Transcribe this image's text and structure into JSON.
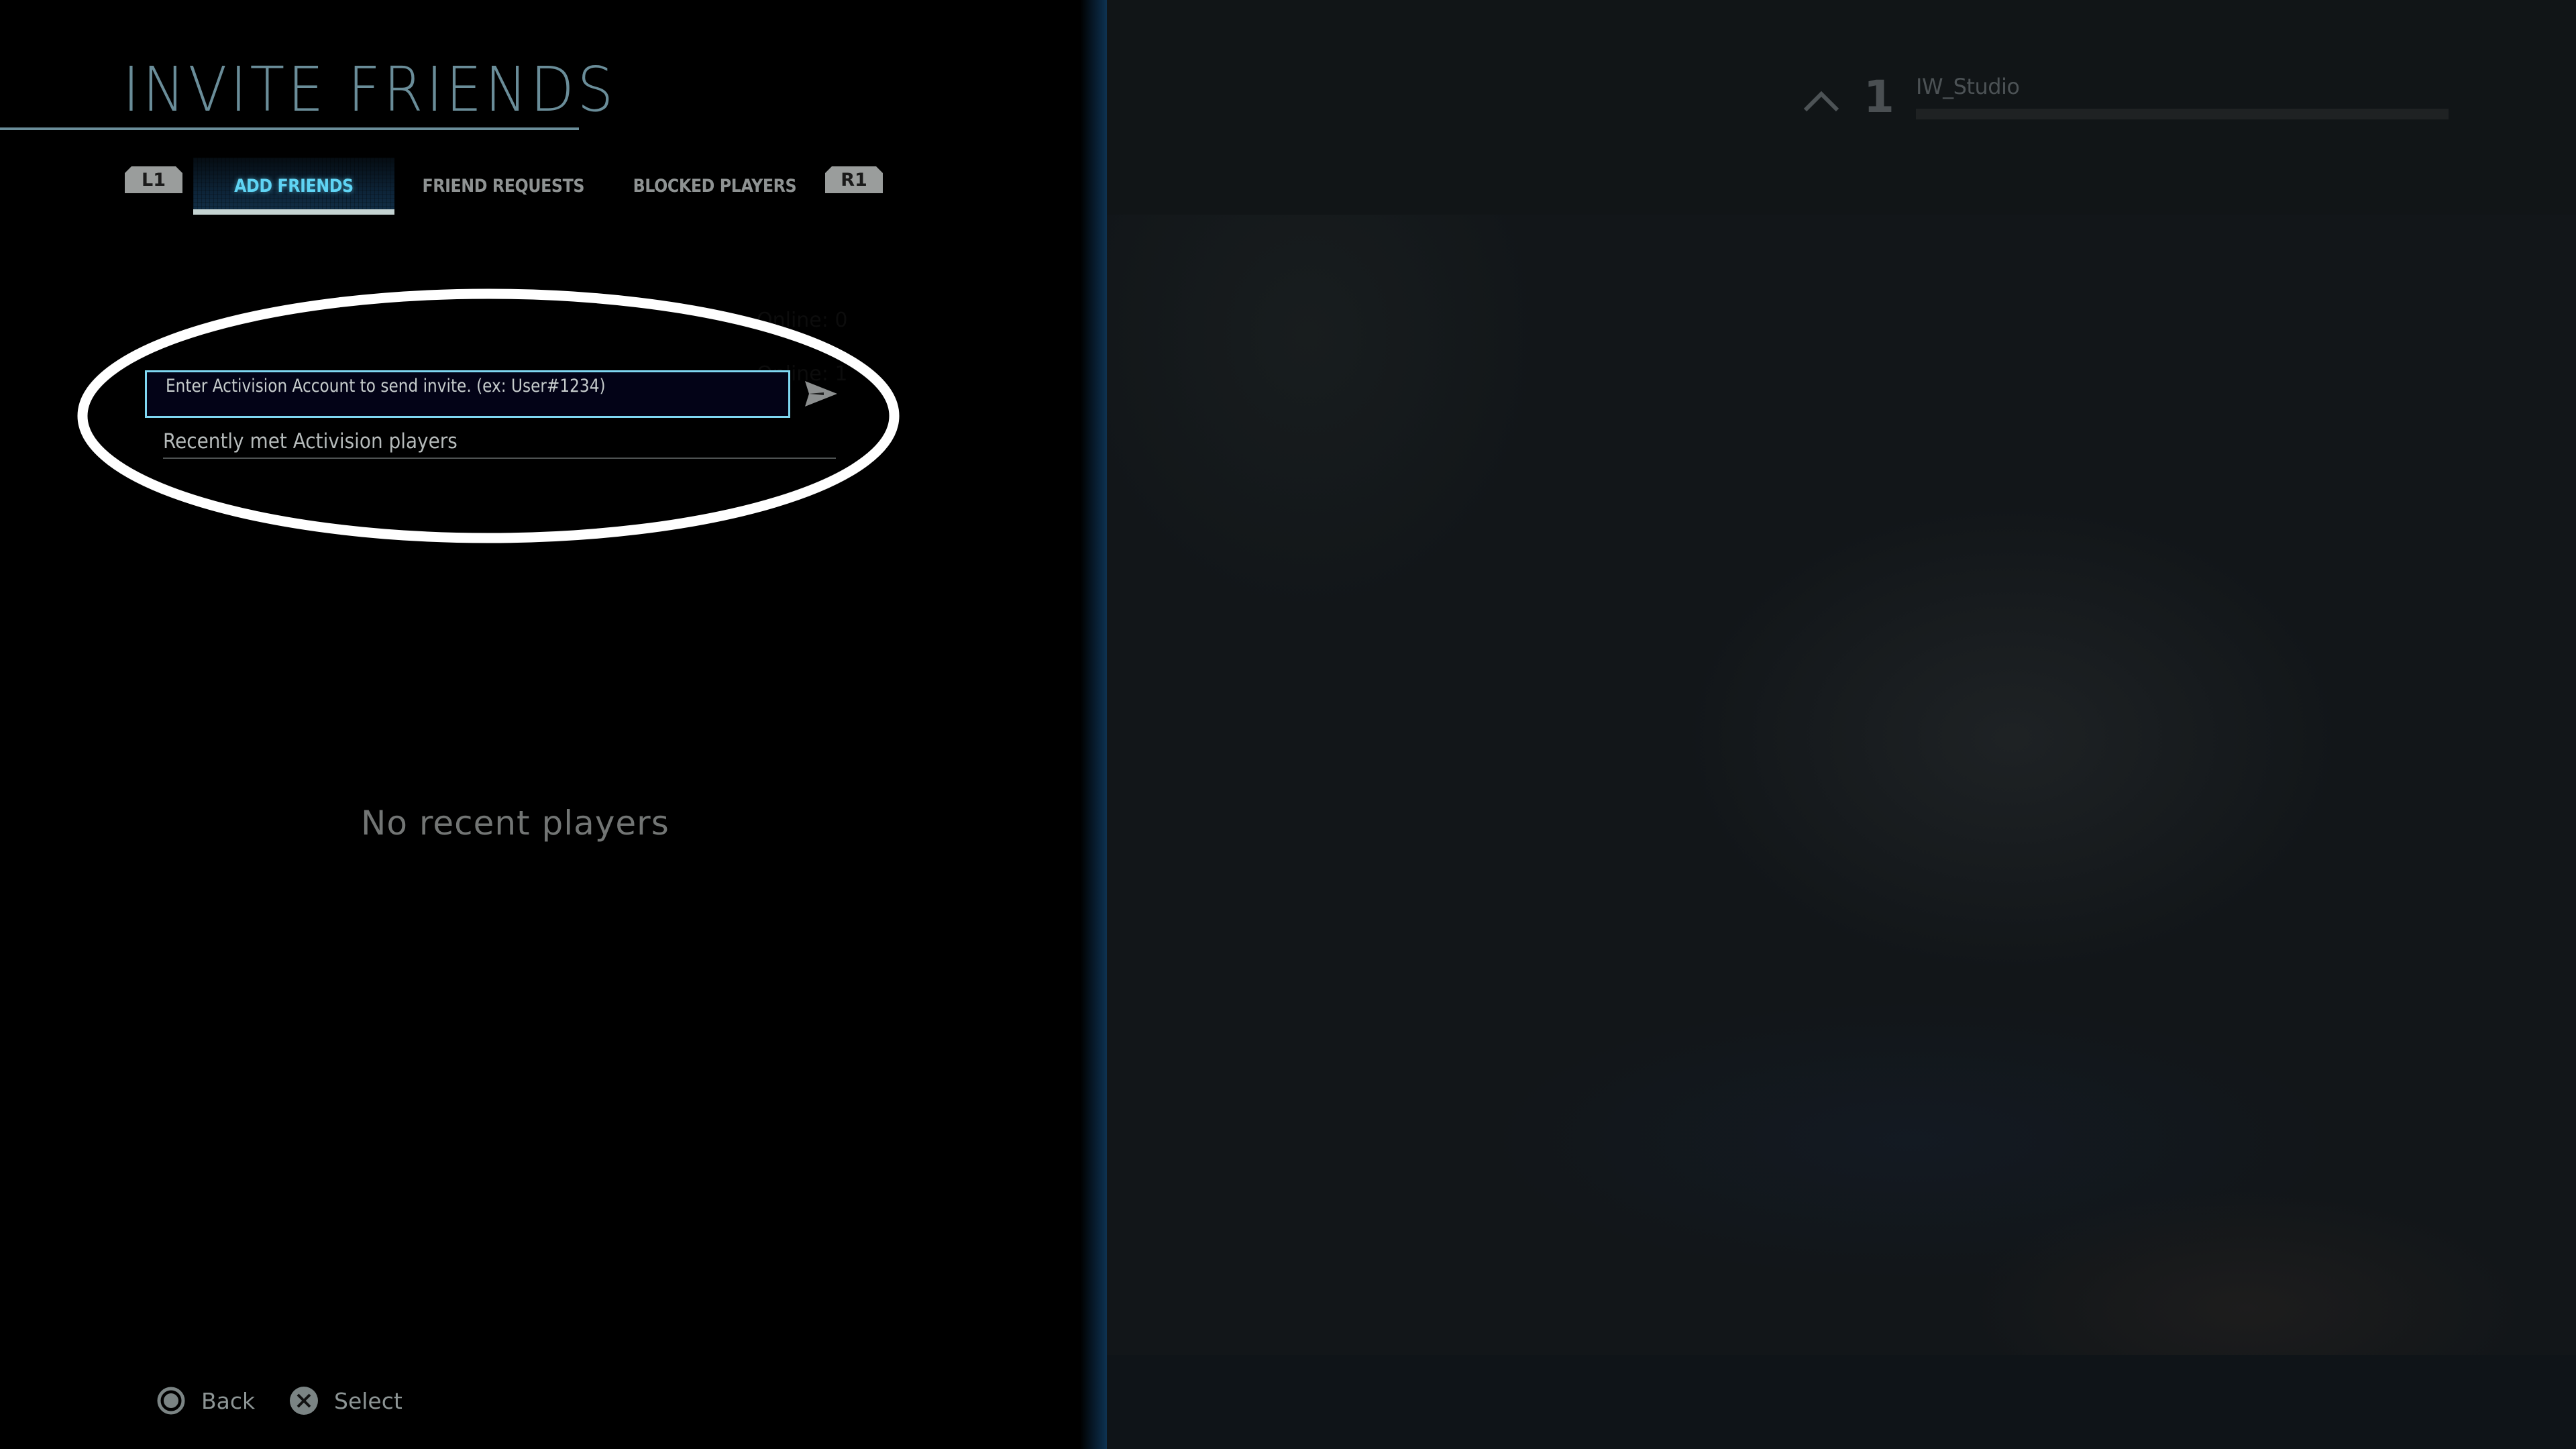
{
  "screen": {
    "title": "INVITE FRIENDS"
  },
  "tabs": {
    "prev_button": "L1",
    "next_button": "R1",
    "items": [
      {
        "label": "ADD FRIENDS",
        "active": true
      },
      {
        "label": "FRIEND REQUESTS",
        "active": false
      },
      {
        "label": "BLOCKED PLAYERS",
        "active": false
      }
    ]
  },
  "add_friends": {
    "input_placeholder": "Enter Activision Account to send invite. (ex: User#1234)",
    "input_value": "",
    "send_icon": "send-arrow-icon",
    "recent_section_label": "Recently met Activision players",
    "empty_state": "No recent players",
    "ghost_rows": [
      "Online: 0",
      "Online: 1"
    ]
  },
  "background_panel": {
    "rank_icon": "chevron-up-icon",
    "rank": "1",
    "player_name": "IW_Studio",
    "progress": 0
  },
  "footer": {
    "prompts": [
      {
        "icon": "circle-button-icon",
        "label": "Back"
      },
      {
        "icon": "cross-button-icon",
        "label": "Select"
      }
    ]
  },
  "colors": {
    "accent_active_tab": "#5fd4f4",
    "input_border": "#7fd7f2",
    "title": "#6a8d99",
    "annotation": "#ffffff"
  }
}
